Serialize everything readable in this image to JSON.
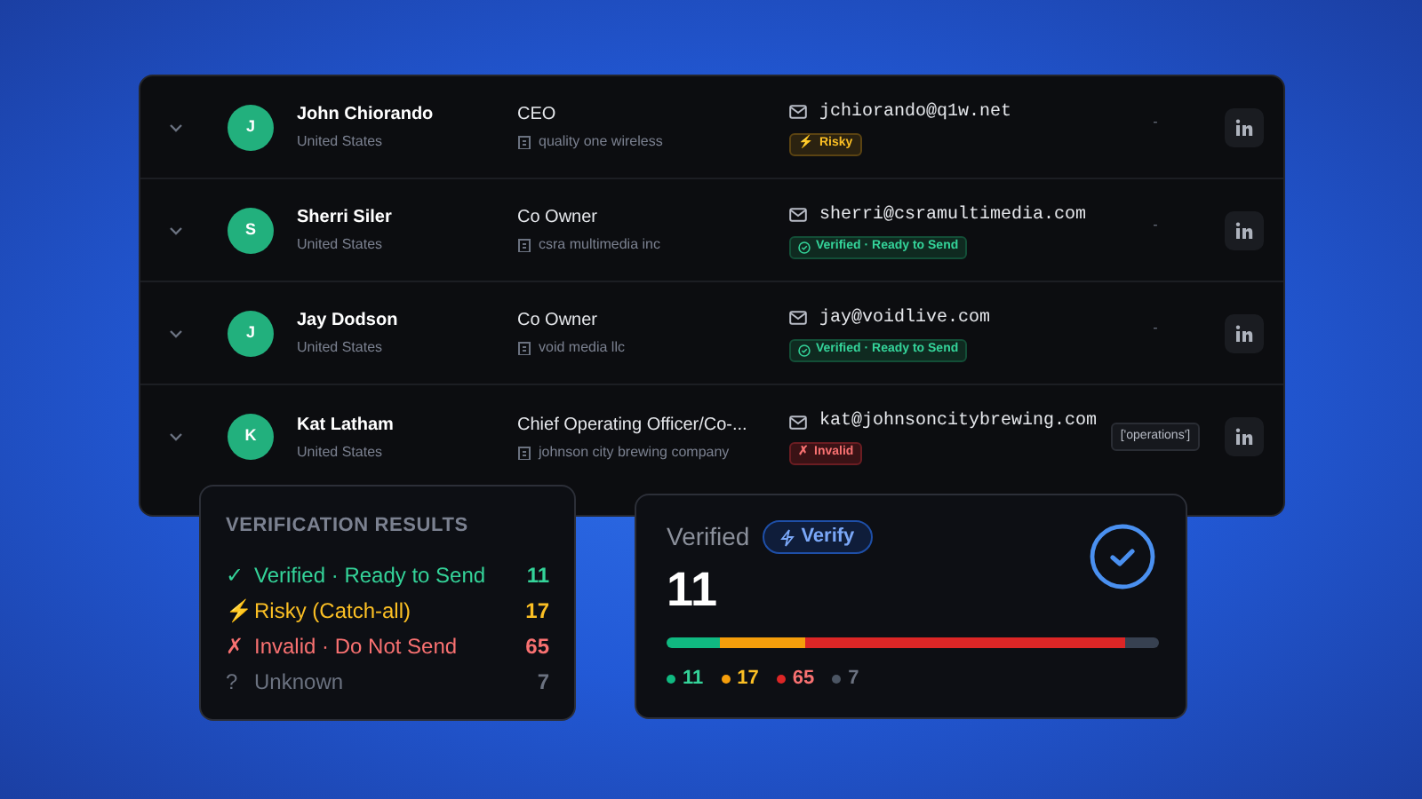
{
  "contacts": [
    {
      "initial": "J",
      "name": "John Chiorando",
      "country": "United States",
      "title": "CEO",
      "company": "quality one wireless",
      "email": "jchiorando@q1w.net",
      "status": {
        "kind": "risky",
        "icon": "⚡",
        "label": "Risky"
      },
      "column_5": {
        "kind": "text",
        "text": "-"
      }
    },
    {
      "initial": "S",
      "name": "Sherri Siler",
      "country": "United States",
      "title": "Co Owner",
      "company": "csra multimedia inc",
      "email": "sherri@csramultimedia.com",
      "status": {
        "kind": "verified",
        "label": "Verified · Ready to Send"
      },
      "column_5": {
        "kind": "text",
        "text": "-"
      }
    },
    {
      "initial": "J",
      "name": "Jay Dodson",
      "country": "United States",
      "title": "Co Owner",
      "company": "void media llc",
      "email": "jay@voidlive.com",
      "status": {
        "kind": "verified",
        "label": "Verified · Ready to Send"
      },
      "column_5": {
        "kind": "text",
        "text": "-"
      }
    },
    {
      "initial": "K",
      "name": "Kat Latham",
      "country": "United States",
      "title": "Chief Operating Officer/Co-...",
      "company": "johnson city brewing company",
      "email": "kat@johnsoncitybrewing.com",
      "status": {
        "kind": "invalid",
        "icon": "✗",
        "label": "Invalid"
      },
      "column_5": {
        "kind": "tag",
        "text": "['operations']"
      }
    }
  ],
  "verification_results": {
    "title": "VERIFICATION RESULTS",
    "items": [
      {
        "kind": "verified",
        "icon": "✓",
        "label": "Verified · Ready to Send",
        "count": "11"
      },
      {
        "kind": "risky",
        "icon": "⚡",
        "label": "Risky (Catch-all)",
        "count": "17"
      },
      {
        "kind": "invalid",
        "icon": "✗",
        "label": "Invalid · Do Not Send",
        "count": "65"
      },
      {
        "kind": "unknown",
        "icon": "?",
        "label": "Unknown",
        "count": "7"
      }
    ]
  },
  "verified_card": {
    "label": "Verified",
    "button": "Verify",
    "count": "11",
    "segments": [
      {
        "kind": "verified",
        "color": "#10b981",
        "legend": "11"
      },
      {
        "kind": "risky",
        "color": "#f59e0b",
        "legend": "17"
      },
      {
        "kind": "invalid",
        "color": "#dc2626",
        "legend": "65"
      },
      {
        "kind": "unknown",
        "color": "#374151",
        "legend": "7"
      }
    ]
  }
}
